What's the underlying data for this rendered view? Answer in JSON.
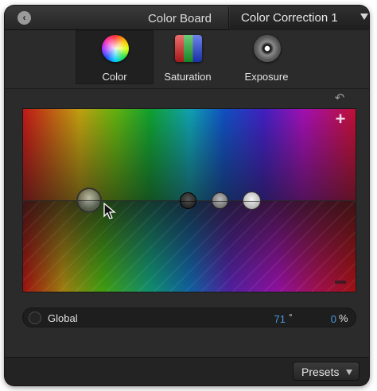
{
  "titlebar": {
    "back_icon": "chevron-left-icon",
    "title": "Color Board",
    "correction": {
      "selected": "Color Correction 1",
      "arrow_icon": "chevron-down-icon"
    }
  },
  "tabs": [
    {
      "label": "Color",
      "icon": "color-wheel-icon",
      "active": true
    },
    {
      "label": "Saturation",
      "icon": "saturation-swatch-icon",
      "active": false
    },
    {
      "label": "Exposure",
      "icon": "exposure-dial-icon",
      "active": false
    }
  ],
  "board": {
    "reset_icon": "reset-icon",
    "add_glyph": "+",
    "pucks": [
      "global",
      "shadows",
      "midtones",
      "highlights"
    ]
  },
  "global": {
    "label": "Global",
    "angle": "71",
    "angle_unit": "°",
    "percent": "0",
    "percent_unit": "%"
  },
  "footer": {
    "presets_label": "Presets",
    "presets_arrow_icon": "chevron-down-icon"
  },
  "colors": {
    "panel_bg": "#2b2b2b",
    "value_blue": "#4a9ae0",
    "text": "#e0e0e0"
  }
}
